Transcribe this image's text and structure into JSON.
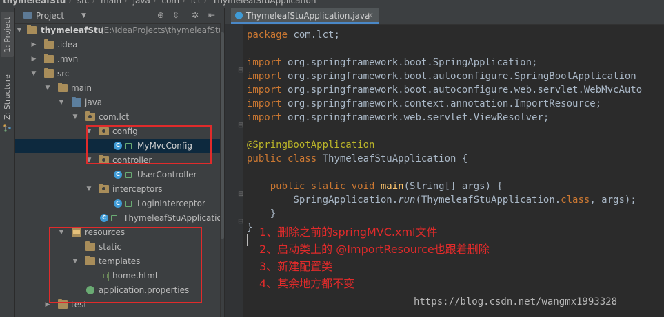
{
  "breadcrumb": [
    "thymeleafStu",
    "src",
    "main",
    "java",
    "com",
    "lct",
    "ThymeleafStuApplication"
  ],
  "left_strip": {
    "project_tab": "1: Project",
    "structure_tab": "Z: Structure"
  },
  "project_panel": {
    "title": "Project",
    "tree": [
      {
        "label": "thymeleafStu",
        "path": "(E:\\IdeaProjects\\thymeleafStu"
      },
      {
        "label": ".idea"
      },
      {
        "label": ".mvn"
      },
      {
        "label": "src"
      },
      {
        "label": "main"
      },
      {
        "label": "java"
      },
      {
        "label": "com.lct"
      },
      {
        "label": "config"
      },
      {
        "label": "MyMvcConfig"
      },
      {
        "label": "controller"
      },
      {
        "label": "UserController"
      },
      {
        "label": "interceptors"
      },
      {
        "label": "LoginInterceptor"
      },
      {
        "label": "ThymeleafStuApplicatio"
      },
      {
        "label": "resources"
      },
      {
        "label": "static"
      },
      {
        "label": "templates"
      },
      {
        "label": "home.html"
      },
      {
        "label": "application.properties"
      },
      {
        "label": "test"
      }
    ]
  },
  "editor": {
    "tab_title": "ThymeleafStuApplication.java",
    "lines": [
      {
        "kw": "package",
        "rest": " com.lct;"
      },
      {
        "kw": "",
        "rest": ""
      },
      {
        "kw": "import",
        "rest": " org.springframework.boot.SpringApplication;"
      },
      {
        "kw": "import",
        "rest": " org.springframework.boot.autoconfigure.SpringBootApplication"
      },
      {
        "kw": "import",
        "rest": " org.springframework.boot.autoconfigure.web.servlet.WebMvcAuto"
      },
      {
        "kw": "import",
        "rest": " org.springframework.context.annotation.ImportResource;"
      },
      {
        "kw": "import",
        "rest": " org.springframework.web.servlet.ViewResolver;"
      },
      {
        "kw": "",
        "rest": ""
      },
      {
        "ann": "@SpringBootApplication"
      },
      {
        "kw": "public class",
        "rest": " ThymeleafStuApplication {"
      },
      {
        "kw": "",
        "rest": ""
      },
      {
        "indent": "    ",
        "kw": "public static void",
        "fn": " main",
        "rest": "(String[] args) {"
      },
      {
        "indent": "        ",
        "kw": "",
        "pre": "SpringApplication.",
        "it": "run",
        "rest2": "(ThymeleafStuApplication.",
        "kw2": "class",
        "rest3": ", args);"
      },
      {
        "indent": "    ",
        "kw": "",
        "rest": "}"
      },
      {
        "kw": "",
        "rest": "}"
      }
    ],
    "notes": [
      "1、删除之前的springMVC.xml文件",
      "2、启动类上的 @ImportResource也跟着删除",
      "3、新建配置类",
      "4、其余地方都不变"
    ],
    "watermark": "https://blog.csdn.net/wangmx1993328"
  },
  "colors": {
    "highlight_box": "#e02b2b",
    "selection": "#0d293e",
    "keyword": "#cc7832",
    "annotation": "#bbb529"
  }
}
